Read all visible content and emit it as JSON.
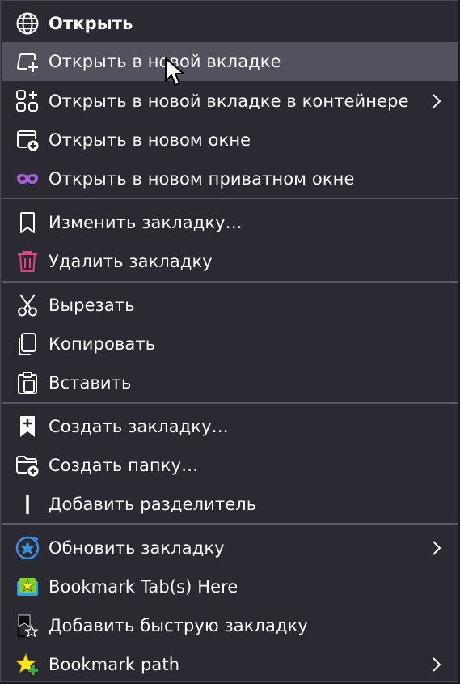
{
  "menu": {
    "items": [
      {
        "label": "Открыть",
        "icon": "globe-icon"
      },
      {
        "label": "Открыть в новой вкладке",
        "icon": "new-tab-icon"
      },
      {
        "label": "Открыть в новой вкладке в контейнере",
        "icon": "containers-icon",
        "submenu": true
      },
      {
        "label": "Открыть в новом окне",
        "icon": "new-window-icon"
      },
      {
        "label": "Открыть в новом приватном окне",
        "icon": "private-mask-icon"
      },
      {
        "label": "Изменить закладку…",
        "icon": "bookmark-outline-icon"
      },
      {
        "label": "Удалить закладку",
        "icon": "trash-icon"
      },
      {
        "label": "Вырезать",
        "icon": "scissors-icon"
      },
      {
        "label": "Копировать",
        "icon": "copy-icon"
      },
      {
        "label": "Вставить",
        "icon": "clipboard-icon"
      },
      {
        "label": "Создать закладку…",
        "icon": "bookmark-add-icon"
      },
      {
        "label": "Создать папку…",
        "icon": "folder-add-icon"
      },
      {
        "label": "Добавить разделитель",
        "icon": "separator-icon"
      },
      {
        "label": "Обновить закладку",
        "icon": "refresh-star-icon",
        "submenu": true
      },
      {
        "label": "Bookmark Tab(s) Here",
        "icon": "bookmark-tabs-here-icon"
      },
      {
        "label": "Добавить быструю закладку",
        "icon": "quick-bookmark-icon"
      },
      {
        "label": "Bookmark path",
        "icon": "bookmark-path-star-icon",
        "submenu": true
      }
    ],
    "hovered_item": "Открыть в новой вкладке"
  },
  "colors": {
    "menu_background": "#2b2a33",
    "hover_background": "#52525e",
    "text": "#fbfbfe",
    "separator": "#5a5a66",
    "trash_accent": "#e5457b",
    "private_accent": "#a061d1"
  }
}
